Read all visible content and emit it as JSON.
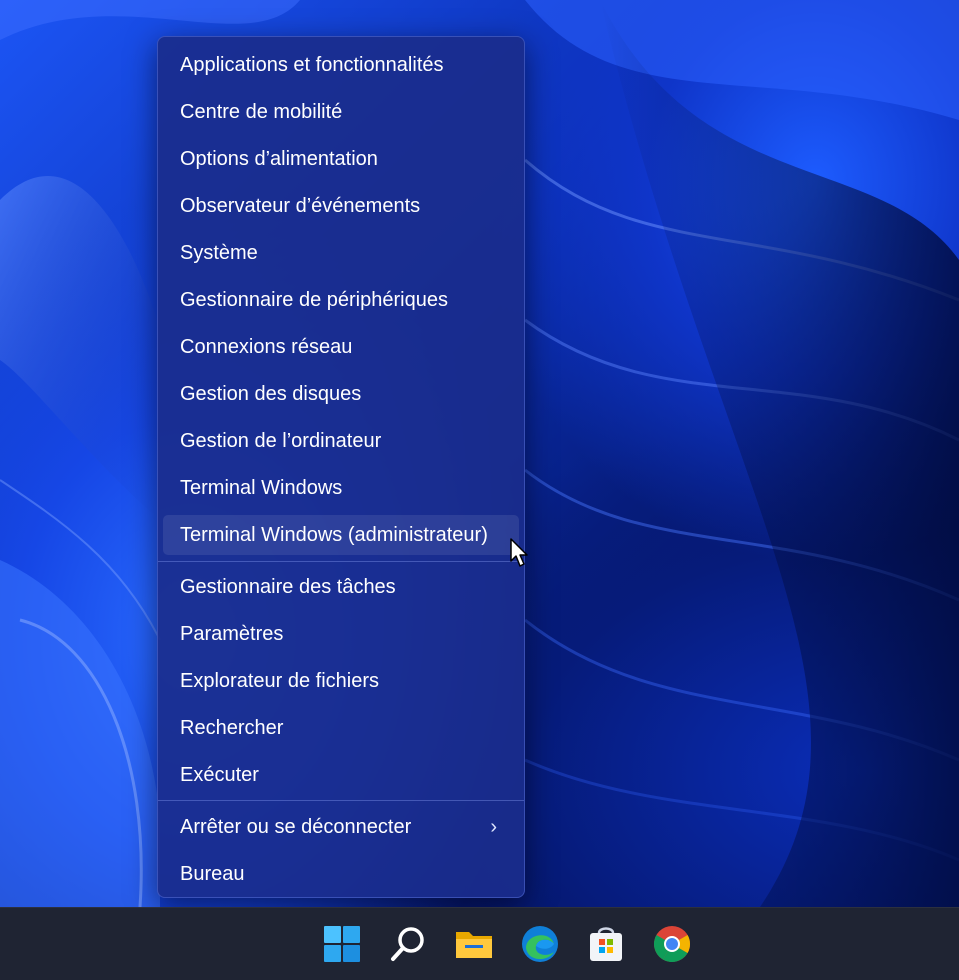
{
  "menu": {
    "items": [
      {
        "label": "Applications et fonctionnalités"
      },
      {
        "label": "Centre de mobilité"
      },
      {
        "label": "Options d’alimentation"
      },
      {
        "label": "Observateur d’événements"
      },
      {
        "label": "Système"
      },
      {
        "label": "Gestionnaire de périphériques"
      },
      {
        "label": "Connexions réseau"
      },
      {
        "label": "Gestion des disques"
      },
      {
        "label": "Gestion de l’ordinateur"
      },
      {
        "label": "Terminal Windows"
      },
      {
        "label": "Terminal Windows (administrateur)",
        "hovered": true
      },
      {
        "label": "Gestionnaire des tâches"
      },
      {
        "label": "Paramètres"
      },
      {
        "label": "Explorateur de fichiers"
      },
      {
        "label": "Rechercher"
      },
      {
        "label": "Exécuter"
      },
      {
        "label": "Arrêter ou se déconnecter",
        "submenu": true,
        "chevron": "›"
      },
      {
        "label": "Bureau"
      }
    ]
  },
  "taskbar": {
    "icons": [
      "start-icon",
      "search-icon",
      "file-explorer-icon",
      "edge-icon",
      "store-icon",
      "chrome-icon"
    ]
  },
  "colors": {
    "menu_bg": "#1a2d8c",
    "taskbar_bg": "#1f2433",
    "text": "#ffffff"
  }
}
